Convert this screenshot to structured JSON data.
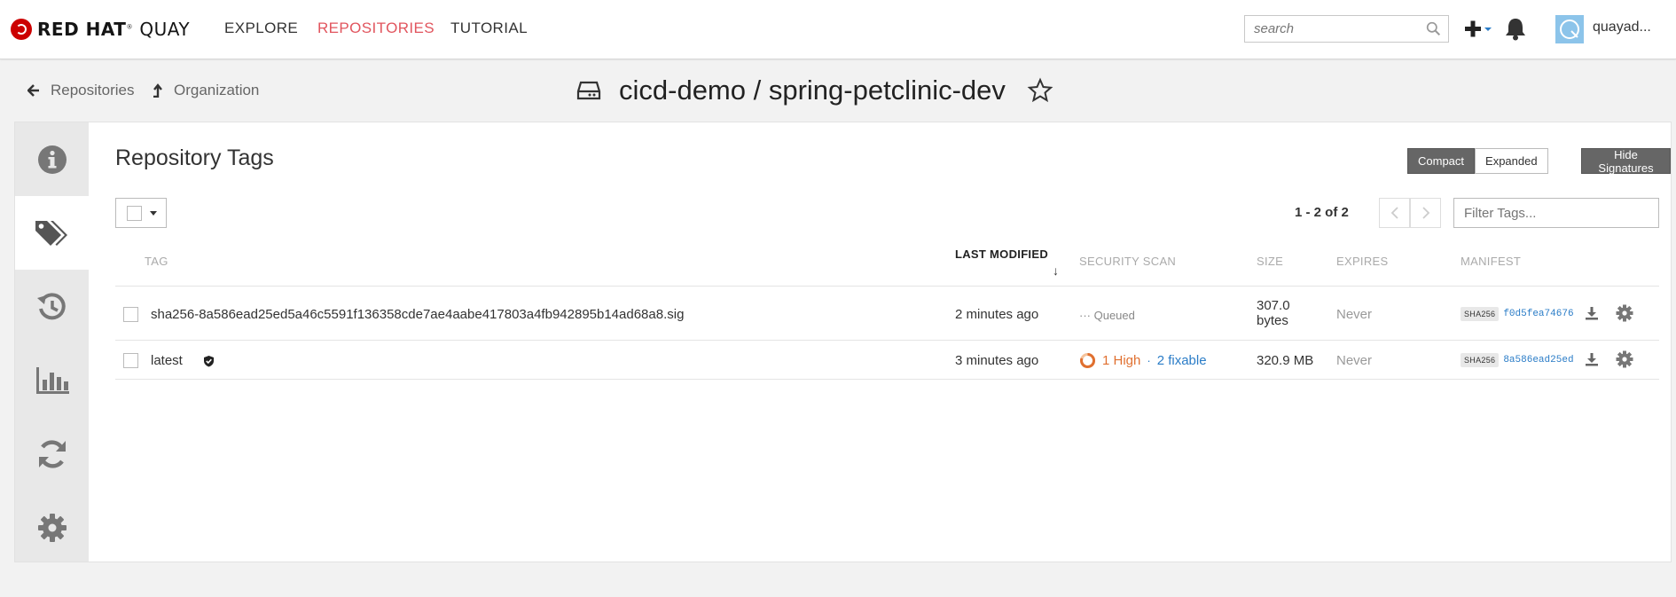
{
  "colors": {
    "brand_red": "#cc0000",
    "nav_active": "#e1555e",
    "accent_blue": "#2a7cc7",
    "vuln_high": "#e07030"
  },
  "navbar": {
    "brand_main": "RED HAT",
    "brand_suffix": "QUAY",
    "links": [
      {
        "label": "EXPLORE",
        "active": false
      },
      {
        "label": "REPOSITORIES",
        "active": true
      },
      {
        "label": "TUTORIAL",
        "active": false
      }
    ],
    "search_placeholder": "search",
    "username": "quayad..."
  },
  "breadcrumb": {
    "back_label": "Repositories",
    "up_label": "Organization"
  },
  "repo": {
    "title": "cicd-demo / spring-petclinic-dev"
  },
  "sidebar": {
    "items": [
      {
        "icon": "info-icon"
      },
      {
        "icon": "tags-icon",
        "active": true
      },
      {
        "icon": "history-icon"
      },
      {
        "icon": "usage-chart-icon"
      },
      {
        "icon": "builds-icon"
      },
      {
        "icon": "settings-icon"
      }
    ]
  },
  "tags_view": {
    "title": "Repository Tags",
    "view_buttons": {
      "compact": "Compact",
      "expanded": "Expanded"
    },
    "hide_signatures": "Hide Signatures",
    "pagination": "1 - 2 of 2",
    "filter_placeholder": "Filter Tags...",
    "columns": {
      "tag": "TAG",
      "last_modified": "LAST MODIFIED",
      "security_scan": "SECURITY SCAN",
      "size": "SIZE",
      "expires": "EXPIRES",
      "manifest": "MANIFEST"
    },
    "sort_indicator": "↓",
    "rows": [
      {
        "tag": "sha256-8a586ead25ed5a46c5591f136358cde7ae4aabe417803a4fb942895b14ad68a8.sig",
        "last_modified": "2 minutes ago",
        "scan_status": "Queued",
        "size_line1": "307.0",
        "size_line2": "bytes",
        "expires": "Never",
        "manifest_algo": "SHA256",
        "manifest_digest": "f0d5fea74676"
      },
      {
        "tag": "latest",
        "signed": true,
        "last_modified": "3 minutes ago",
        "scan_high": "1 High",
        "scan_sep": "·",
        "scan_fixable": "2 fixable",
        "size": "320.9 MB",
        "expires": "Never",
        "manifest_algo": "SHA256",
        "manifest_digest": "8a586ead25ed"
      }
    ]
  }
}
